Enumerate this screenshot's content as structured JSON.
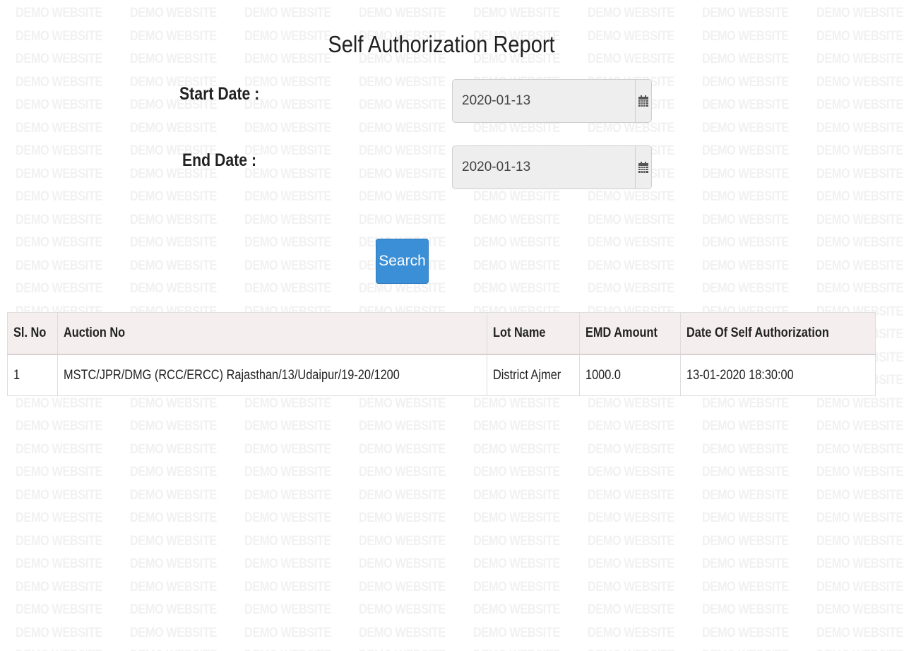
{
  "watermark": {
    "text": "DEMO WEBSITE"
  },
  "report": {
    "title": "Self Authorization Report"
  },
  "form": {
    "start_date": {
      "label": "Start Date :",
      "value": "2020-01-13",
      "icon": "calendar-icon"
    },
    "end_date": {
      "label": "End Date :",
      "value": "2020-01-13",
      "icon": "calendar-icon"
    },
    "search_label": "Search"
  },
  "table": {
    "headers": [
      "Sl. No",
      "Auction No",
      "Lot Name",
      "EMD Amount",
      "Date Of Self Authorization"
    ],
    "rows": [
      [
        "1",
        "MSTC/JPR/DMG (RCC/ERCC) Rajasthan/13/Udaipur/19-20/1200",
        "District Ajmer",
        "1000.0",
        "13-01-2020 18:30:00"
      ]
    ]
  },
  "colors": {
    "search_button": "#3a8fd6",
    "table_header": "#f4eeee",
    "input_background": "#eeeeee"
  }
}
